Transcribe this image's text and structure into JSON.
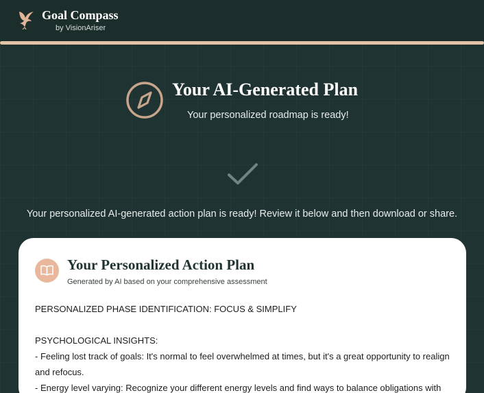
{
  "brand": {
    "title": "Goal Compass",
    "subtitle": "by VisionAriser",
    "logo_icon": "phoenix-bird-icon"
  },
  "hero": {
    "icon": "compass-icon",
    "title": "Your AI-Generated Plan",
    "subtitle": "Your personalized roadmap is ready!"
  },
  "status": {
    "icon": "checkmark-icon",
    "message": "Your personalized AI-generated action plan is ready! Review it below and then download or share."
  },
  "plan_card": {
    "icon": "open-book-icon",
    "title": "Your Personalized Action Plan",
    "subtitle": "Generated by AI based on your comprehensive assessment",
    "lines": [
      "PERSONALIZED PHASE IDENTIFICATION: FOCUS & SIMPLIFY",
      "",
      "PSYCHOLOGICAL INSIGHTS:",
      "- Feeling lost track of goals: It's normal to feel overwhelmed at times, but it's a great opportunity to realign and refocus.",
      "- Energy level varying: Recognize your different energy levels and find ways to balance obligations with"
    ]
  },
  "colors": {
    "background": "#1f3432",
    "header": "#1b2e2c",
    "accent": "#e5c3a6",
    "icon_badge": "#e8b79c",
    "card": "#ffffff"
  }
}
